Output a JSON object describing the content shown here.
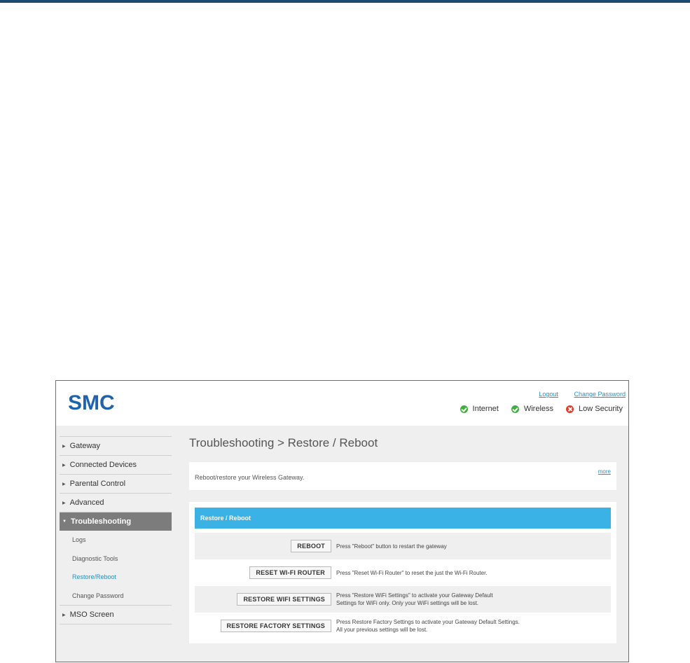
{
  "header": {
    "logo": "SMC",
    "links": {
      "logout": "Logout",
      "change_password": "Change Password"
    },
    "status": [
      {
        "label": "Internet",
        "state": "ok",
        "icon": "check-circle-icon"
      },
      {
        "label": "Wireless",
        "state": "ok",
        "icon": "check-circle-icon"
      },
      {
        "label": "Low Security",
        "state": "bad",
        "icon": "x-circle-icon"
      }
    ],
    "colors": {
      "ok": "#3fae3f",
      "bad": "#e13b2a",
      "logo": "#1f63ae"
    }
  },
  "sidebar": {
    "items": [
      {
        "label": "Gateway"
      },
      {
        "label": "Connected Devices"
      },
      {
        "label": "Parental Control"
      },
      {
        "label": "Advanced"
      },
      {
        "label": "Troubleshooting",
        "active": true
      },
      {
        "label": "MSO Screen"
      }
    ],
    "subitems": [
      {
        "label": "Logs"
      },
      {
        "label": "Diagnostic Tools"
      },
      {
        "label": "Restore/Reboot",
        "current": true
      },
      {
        "label": "Change Password"
      }
    ]
  },
  "main": {
    "title": "Troubleshooting > Restore / Reboot",
    "description": "Reboot/restore your Wireless Gateway.",
    "more_label": "more",
    "panel_title": "Restore / Reboot",
    "accent_color": "#3ab2e6",
    "actions": [
      {
        "button": "REBOOT",
        "text": "Press \"Reboot\" button to restart the gateway"
      },
      {
        "button": "RESET WI-FI ROUTER",
        "text": "Press \"Reset Wi-Fi Router\" to reset the just the Wi-Fi Router."
      },
      {
        "button": "RESTORE WIFI SETTINGS",
        "text": "Press \"Restore WiFi Settings\" to activate your Gateway Default\nSettings for WiFi only. Only your WiFi settings will be lost."
      },
      {
        "button": "RESTORE FACTORY SETTINGS",
        "text": "Press Restore Factory Settings to activate your Gateway Default Settings.\nAll your previous settings will be lost."
      }
    ]
  }
}
